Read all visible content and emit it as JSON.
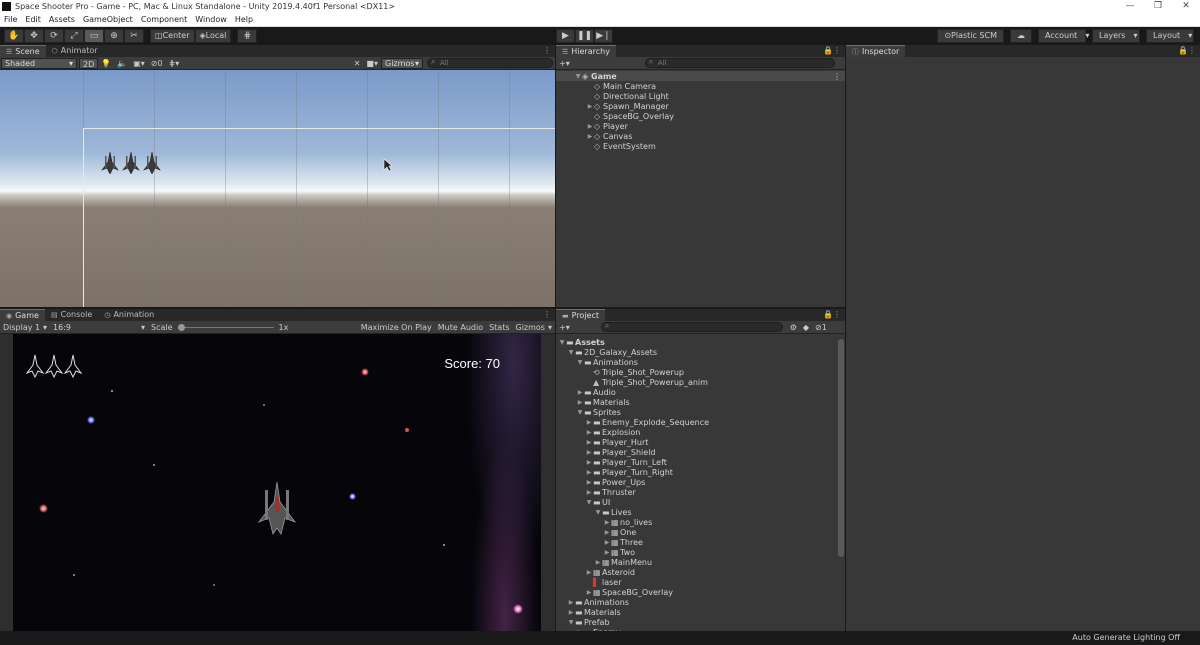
{
  "window": {
    "title": "Space Shooter Pro - Game - PC, Mac & Linux Standalone - Unity 2019.4.40f1 Personal <DX11>",
    "controls": [
      "—",
      "❐",
      "✕"
    ]
  },
  "menu": [
    "File",
    "Edit",
    "Assets",
    "GameObject",
    "Component",
    "Window",
    "Help"
  ],
  "toolbar": {
    "tools": [
      "hand-icon",
      "move-icon",
      "rotate-icon",
      "scale-icon",
      "rect-icon",
      "transform-icon",
      "custom-tool-icon"
    ],
    "pivot": "Center",
    "space": "Local",
    "play_icons": [
      "▶",
      "❚❚",
      "▶❘"
    ],
    "plastic": "Plastic SCM",
    "account": "Account",
    "layers": "Layers",
    "layout": "Layout"
  },
  "scene": {
    "tabs": [
      "Scene",
      "Animator"
    ],
    "shading": "Shaded",
    "mode_2d": "2D",
    "hidden_count": "0",
    "gizmos": "Gizmos",
    "search_placeholder": "All"
  },
  "game": {
    "tabs": [
      "Game",
      "Console",
      "Animation"
    ],
    "display": "Display 1",
    "aspect": "16:9",
    "scale_label": "Scale",
    "scale_value": "1x",
    "maximize": "Maximize On Play",
    "mute": "Mute Audio",
    "stats": "Stats",
    "gizmos": "Gizmos",
    "score": "Score: 70"
  },
  "hierarchy": {
    "tab": "Hierarchy",
    "search_placeholder": "All",
    "scene_name": "Game",
    "items": [
      {
        "label": "Main Camera",
        "expandable": false
      },
      {
        "label": "Directional Light",
        "expandable": false
      },
      {
        "label": "Spawn_Manager",
        "expandable": true
      },
      {
        "label": "SpaceBG_Overlay",
        "expandable": false
      },
      {
        "label": "Player",
        "expandable": true
      },
      {
        "label": "Canvas",
        "expandable": true
      },
      {
        "label": "EventSystem",
        "expandable": false
      }
    ]
  },
  "project": {
    "tab": "Project",
    "hidden_count": "1",
    "tree": [
      {
        "label": "Assets",
        "depth": 0,
        "arrow": "▼",
        "type": "folder",
        "bold": true
      },
      {
        "label": "2D_Galaxy_Assets",
        "depth": 1,
        "arrow": "▼",
        "type": "folder"
      },
      {
        "label": "Animations",
        "depth": 2,
        "arrow": "▼",
        "type": "folder"
      },
      {
        "label": "Triple_Shot_Powerup",
        "depth": 3,
        "arrow": "",
        "type": "anim"
      },
      {
        "label": "Triple_Shot_Powerup_anim",
        "depth": 3,
        "arrow": "",
        "type": "clip"
      },
      {
        "label": "Audio",
        "depth": 2,
        "arrow": "▶",
        "type": "folder"
      },
      {
        "label": "Materials",
        "depth": 2,
        "arrow": "▶",
        "type": "folder"
      },
      {
        "label": "Sprites",
        "depth": 2,
        "arrow": "▼",
        "type": "folder"
      },
      {
        "label": "Enemy_Explode_Sequence",
        "depth": 3,
        "arrow": "▶",
        "type": "folder"
      },
      {
        "label": "Explosion",
        "depth": 3,
        "arrow": "▶",
        "type": "folder"
      },
      {
        "label": "Player_Hurt",
        "depth": 3,
        "arrow": "▶",
        "type": "folder"
      },
      {
        "label": "Player_Shield",
        "depth": 3,
        "arrow": "▶",
        "type": "folder"
      },
      {
        "label": "Player_Turn_Left",
        "depth": 3,
        "arrow": "▶",
        "type": "folder"
      },
      {
        "label": "Player_Turn_Right",
        "depth": 3,
        "arrow": "▶",
        "type": "folder"
      },
      {
        "label": "Power_Ups",
        "depth": 3,
        "arrow": "▶",
        "type": "folder"
      },
      {
        "label": "Thruster",
        "depth": 3,
        "arrow": "▶",
        "type": "folder"
      },
      {
        "label": "UI",
        "depth": 3,
        "arrow": "▼",
        "type": "folder"
      },
      {
        "label": "Lives",
        "depth": 4,
        "arrow": "▼",
        "type": "folder"
      },
      {
        "label": "no_lives",
        "depth": 5,
        "arrow": "▶",
        "type": "sprite"
      },
      {
        "label": "One",
        "depth": 5,
        "arrow": "▶",
        "type": "sprite"
      },
      {
        "label": "Three",
        "depth": 5,
        "arrow": "▶",
        "type": "sprite"
      },
      {
        "label": "Two",
        "depth": 5,
        "arrow": "▶",
        "type": "sprite"
      },
      {
        "label": "MainMenu",
        "depth": 4,
        "arrow": "▶",
        "type": "sprite"
      },
      {
        "label": "Asteroid",
        "depth": 3,
        "arrow": "▶",
        "type": "sprite"
      },
      {
        "label": "laser",
        "depth": 3,
        "arrow": "",
        "type": "laser"
      },
      {
        "label": "SpaceBG_Overlay",
        "depth": 3,
        "arrow": "▶",
        "type": "sprite"
      },
      {
        "label": "Animations",
        "depth": 1,
        "arrow": "▶",
        "type": "folder"
      },
      {
        "label": "Materials",
        "depth": 1,
        "arrow": "▶",
        "type": "folder"
      },
      {
        "label": "Prefab",
        "depth": 1,
        "arrow": "▼",
        "type": "folder"
      },
      {
        "label": "Enemy",
        "depth": 2,
        "arrow": "▶",
        "type": "folder"
      }
    ]
  },
  "inspector": {
    "tab": "Inspector"
  },
  "status": {
    "text": "Auto Generate Lighting Off"
  }
}
